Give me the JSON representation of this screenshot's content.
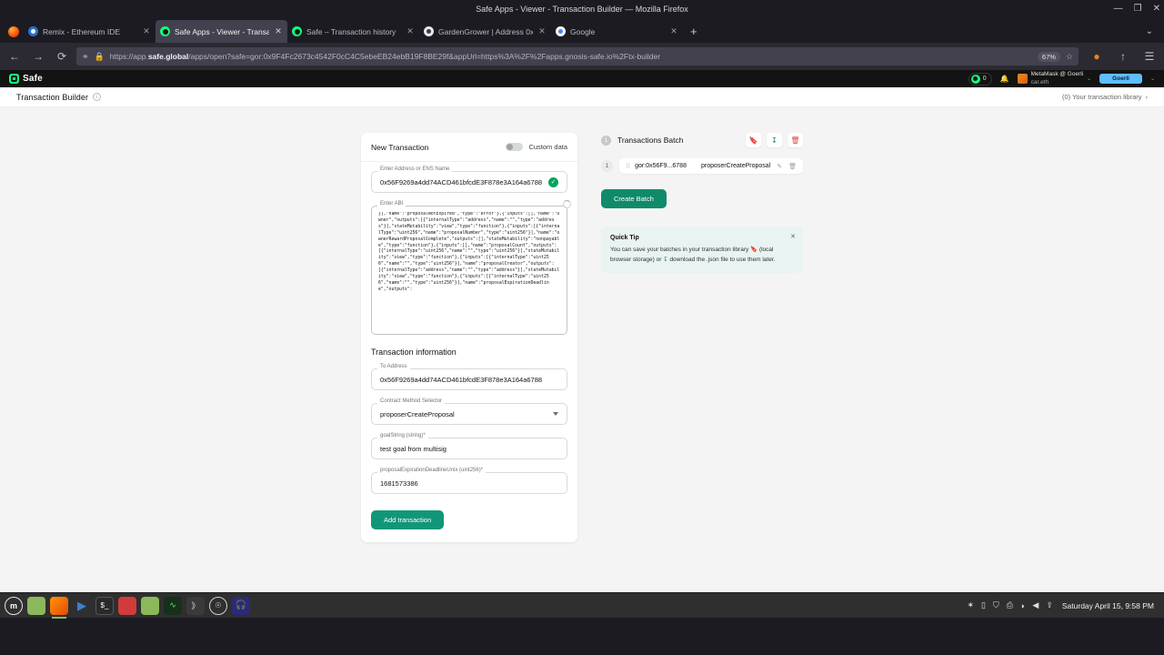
{
  "browser": {
    "window_title": "Safe Apps - Viewer - Transaction Builder — Mozilla Firefox",
    "window_controls": {
      "minimize": "—",
      "maximize": "❐",
      "close": "✕"
    },
    "tabs": [
      {
        "title": "Remix - Ethereum IDE",
        "favicon": "remix-icon",
        "close": "✕",
        "active": false
      },
      {
        "title": "Safe Apps - Viewer - Transac",
        "favicon": "safe-icon",
        "close": "✕",
        "active": true
      },
      {
        "title": "Safe – Transaction history",
        "favicon": "safe-icon",
        "close": "✕",
        "active": false
      },
      {
        "title": "GardenGrower | Address 0x",
        "favicon": "garden-icon",
        "close": "✕",
        "active": false
      },
      {
        "title": "Google",
        "favicon": "google-icon",
        "close": "✕",
        "active": false
      }
    ],
    "new_tab_label": "+",
    "tab_list_chevron": "⌄",
    "nav": {
      "back": "←",
      "forward": "→",
      "reload": "⟳"
    },
    "url": {
      "shield_icon": "shield-icon",
      "lock_icon": "lock-icon",
      "prefix": "https://app.",
      "domain": "safe.global",
      "path": "/apps/open?safe=gor:0x9F4Fc2673c4542F0cC4C5ebeEB24ebB19F8BE29f&appUrl=https%3A%2F%2Fapps.gnosis-safe.io%2Ftx-builder",
      "zoom": "67%",
      "bookmark_icon": "star-icon"
    },
    "toolbar_right": {
      "extension_icon": "firefox-extension-icon",
      "share_icon": "share-icon",
      "menu_icon": "hamburger-menu-icon"
    }
  },
  "safe_header": {
    "brand": "Safe",
    "chain_count": "0",
    "notifications_icon": "bell-icon",
    "wallet_name": "MetaMask @ Goerli",
    "wallet_ens": "car.eth",
    "wallet_chevron": "⌄",
    "network_button": "Goerli",
    "network_chevron": "⌄"
  },
  "subheader": {
    "title": "Transaction Builder",
    "info_icon": "info-icon",
    "library_link": "(0) Your transaction library",
    "library_chevron": "›"
  },
  "new_transaction": {
    "title": "New Transaction",
    "custom_data_label": "Custom data",
    "custom_data_on": false,
    "address_field": {
      "label": "Enter Address or ENS Name",
      "value": "0x56F9269a4dd74ACD461bfcdE3F878e3A164a6788",
      "valid_icon": "check-circle-icon"
    },
    "abi_field": {
      "label": "Enter ABI",
      "value": "}],\"name\":\"proposalNotExpired\",\"type\":\"error\"},{\"inputs\":[],\"name\":\"Owner\",\"outputs\":[{\"internalType\":\"address\",\"name\":\"\",\"type\":\"address\"}],\"stateMutability\":\"view\",\"type\":\"function\"},{\"inputs\":[{\"internalType\":\"uint256\",\"name\":\"proposalNumber\",\"type\":\"uint256\"}],\"name\":\"ownerRewardProposalComplete\",\"outputs\":[],\"stateMutability\":\"nonpayable\",\"type\":\"function\"},{\"inputs\":[],\"name\":\"proposalCount\",\"outputs\":[{\"internalType\":\"uint256\",\"name\":\"\",\"type\":\"uint256\"}],\"stateMutability\":\"view\",\"type\":\"function\"},{\"inputs\":[{\"internalType\":\"uint256\",\"name\":\"\",\"type\":\"uint256\"}],\"name\":\"proposalCreator\",\"outputs\":[{\"internalType\":\"address\",\"name\":\"\",\"type\":\"address\"}],\"stateMutability\":\"view\",\"type\":\"function\"},{\"inputs\":[{\"internalType\":\"uint256\",\"name\":\"\",\"type\":\"uint256\"}],\"name\":\"proposalExpirationDeadline\",\"outputs\":",
      "spinner_icon": "loading-spinner-icon"
    }
  },
  "transaction_information": {
    "title": "Transaction information",
    "to_address": {
      "label": "To Address",
      "value": "0x56F9269a4dd74ACD461bfcdE3F878e3A164a6788"
    },
    "method_selector": {
      "label": "Contract Method Selector",
      "value": "proposerCreateProposal",
      "caret_icon": "chevron-down-icon"
    },
    "params": [
      {
        "label": "goalString (string)*",
        "value": "test goal from multisig"
      },
      {
        "label": "proposalExpirationDeadlineUnix (uint256)*",
        "value": "1681573386"
      }
    ],
    "add_button": "Add transaction"
  },
  "batch_panel": {
    "step_number": "1",
    "title": "Transactions Batch",
    "actions": [
      {
        "name": "save-to-library-icon",
        "glyph": "🔖"
      },
      {
        "name": "download-json-icon",
        "glyph": "⤓"
      },
      {
        "name": "delete-batch-icon",
        "glyph": "🗑"
      }
    ],
    "rows": [
      {
        "index": "1",
        "drag_handle": "⠿",
        "address": "gor:0x56F9...6788",
        "method": "proposerCreateProposal",
        "edit_icon": "pencil-icon",
        "delete_icon": "trash-icon"
      }
    ],
    "create_button": "Create Batch",
    "tip": {
      "title": "Quick Tip",
      "line1": "You can save your batches in your transaction library",
      "line1_icon": "bookmark-icon",
      "line2_prefix": "(local browser storage) or",
      "line2_icon": "download-icon",
      "line2_suffix": "download the .json file to",
      "line3": "use them later.",
      "close": "✕"
    }
  },
  "taskbar": {
    "launchers": [
      {
        "name": "start-menu-icon",
        "glyph": "m"
      },
      {
        "name": "file-manager-icon",
        "glyph": ""
      },
      {
        "name": "firefox-icon",
        "glyph": ""
      },
      {
        "name": "vlc-icon",
        "glyph": "▶"
      },
      {
        "name": "terminal-icon",
        "glyph": "$_"
      },
      {
        "name": "gimp-icon",
        "glyph": ""
      },
      {
        "name": "folder-icon",
        "glyph": ""
      },
      {
        "name": "system-monitor-icon",
        "glyph": "∿"
      },
      {
        "name": "media-player-icon",
        "glyph": "》"
      },
      {
        "name": "settings-wheel-icon",
        "glyph": ""
      },
      {
        "name": "headset-icon",
        "glyph": ""
      }
    ],
    "tray": [
      {
        "name": "bluetooth-icon",
        "glyph": "✶"
      },
      {
        "name": "battery-icon",
        "glyph": "▯"
      },
      {
        "name": "shield-icon",
        "glyph": "⛉"
      },
      {
        "name": "printer-icon",
        "glyph": "⎙"
      },
      {
        "name": "wifi-icon",
        "glyph": "◗"
      },
      {
        "name": "volume-icon",
        "glyph": "◀"
      },
      {
        "name": "updates-icon",
        "glyph": "⇪"
      }
    ],
    "clock": "Saturday April 15,  9:58 PM"
  }
}
